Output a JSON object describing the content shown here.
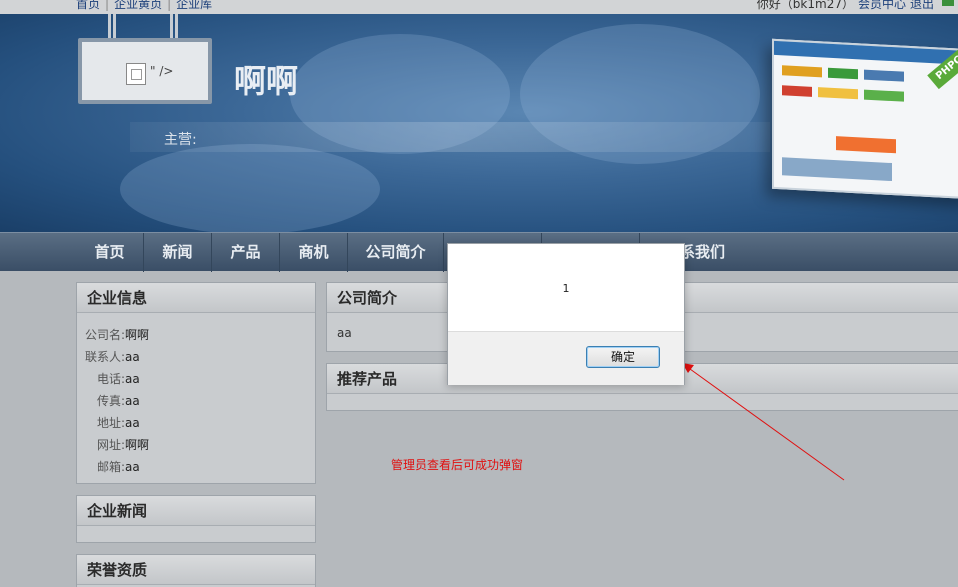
{
  "topbar": {
    "links": [
      "首页",
      "企业黄页",
      "企业库"
    ],
    "greeting": "你好（bk1m27）",
    "member_center": "会员中心",
    "logout": "退出"
  },
  "banner": {
    "logo_alt_text": "\" />",
    "company_name": "啊啊",
    "main_business_label": "主营:",
    "mock_ribbon": "PHPCMS"
  },
  "nav": {
    "items": [
      "首页",
      "新闻",
      "产品",
      "商机",
      "公司简介",
      "",
      "",
      "系我们"
    ]
  },
  "sidebar": {
    "company_info": {
      "title": "企业信息",
      "rows": [
        {
          "key": "公司名:",
          "value": "啊啊"
        },
        {
          "key": "联系人:",
          "value": "aa"
        },
        {
          "key": "电话:",
          "value": "aa"
        },
        {
          "key": "传真:",
          "value": "aa"
        },
        {
          "key": "地址:",
          "value": "aa"
        },
        {
          "key": "网址:",
          "value": "啊啊"
        },
        {
          "key": "邮箱:",
          "value": "aa"
        }
      ]
    },
    "company_news": {
      "title": "企业新闻"
    },
    "honors": {
      "title": "荣誉资质"
    }
  },
  "main": {
    "intro": {
      "title": "公司简介",
      "text": "aa"
    },
    "recommended": {
      "title": "推荐产品"
    }
  },
  "modal": {
    "message": "1",
    "ok_label": "确定"
  },
  "annotation": {
    "text": "管理员查看后可成功弹窗",
    "color": "#e01010"
  }
}
